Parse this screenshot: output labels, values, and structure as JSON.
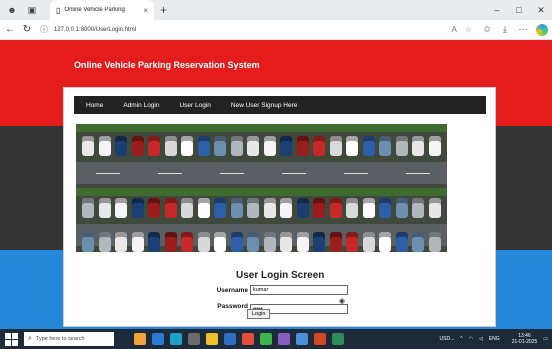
{
  "browser": {
    "tab_title": "Online Vehicle Parking",
    "tab_close": "×",
    "new_tab": "+",
    "url": "127.0.0.1:8000/UserLogin.html",
    "win_min": "–",
    "win_max": "□",
    "win_close": "✕"
  },
  "site": {
    "title": "Online Vehicle Parking Reservation System",
    "menu": [
      {
        "label": "Home"
      },
      {
        "label": "Admin Login"
      },
      {
        "label": "User Login"
      },
      {
        "label": "New User Signup Here"
      }
    ]
  },
  "login": {
    "heading": "User Login Screen",
    "username_label": "Username",
    "username_value": "kumar",
    "password_label": "Password",
    "password_value": "•••••",
    "button_label": "Login"
  },
  "taskbar": {
    "search_placeholder": "Type here to search",
    "weather": "USD...",
    "lang": "ENG",
    "time": "13:46",
    "date": "21-01-2025"
  },
  "colors": {
    "red_band": "#e41c1c",
    "dark_band": "#333333",
    "blue_band": "#2487d8"
  }
}
